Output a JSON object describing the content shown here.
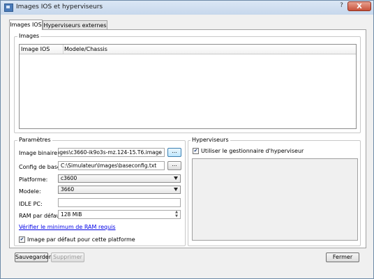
{
  "window": {
    "title": "Images IOS et hyperviseurs",
    "help": "?",
    "close": "X"
  },
  "tabs": [
    {
      "label": "Images IOS"
    },
    {
      "label": "Hyperviseurs externes"
    }
  ],
  "images_group": {
    "title": "Images",
    "columns": [
      "Image IOS",
      "Modele/Chassis"
    ]
  },
  "params": {
    "title": "Paramètres",
    "image_binaire": {
      "label": "Image binaire:",
      "value": "teur\\Images\\c3660-ik9o3s-mz.124-15.T6.image",
      "button": "..."
    },
    "config_base": {
      "label": "Config de base:",
      "value": "C:\\Simulateur\\Images\\baseconfig.txt",
      "button": "..."
    },
    "plateforme": {
      "label": "Platforme:",
      "value": "c3600"
    },
    "modele": {
      "label": "Modele:",
      "value": "3660"
    },
    "idle_pc": {
      "label": "IDLE PC:",
      "value": ""
    },
    "ram": {
      "label": "RAM par défaut:",
      "value": "128 MiB"
    },
    "verify_link": "Vérifier le minimum de RAM requis",
    "default_image": {
      "label": "Image par défaut pour cette platforme",
      "checked": true
    }
  },
  "hyperviseurs": {
    "title": "Hyperviseurs",
    "use_manager": {
      "label": "Utiliser le gestionnaire d'hyperviseur",
      "checked": true
    }
  },
  "buttons": {
    "save": "Sauvegarder",
    "delete": "Supprimer",
    "close": "Fermer"
  }
}
